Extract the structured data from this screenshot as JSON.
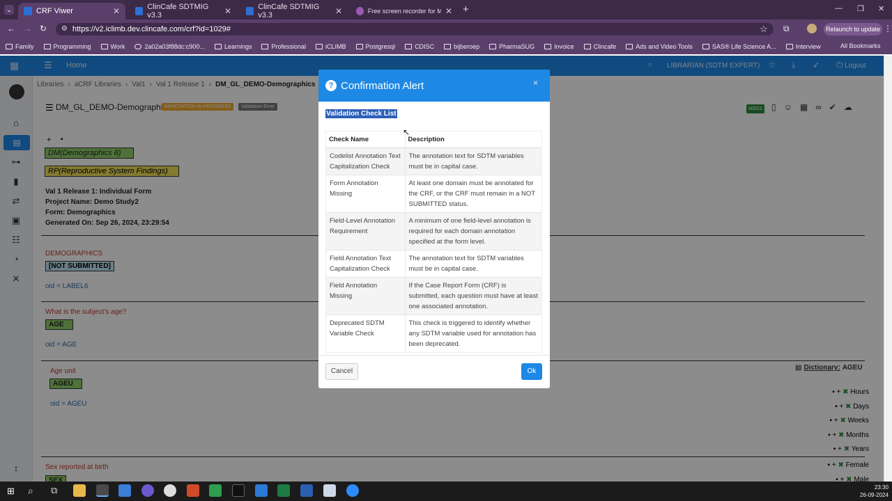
{
  "browser": {
    "tabs": [
      {
        "label": "CRF Viwer",
        "active": true
      },
      {
        "label": "ClinCafe SDTMIG v3.3",
        "active": false
      },
      {
        "label": "ClinCafe SDTMIG v3.3",
        "active": false
      },
      {
        "label": "Free screen recorder for Mac a",
        "active": false
      }
    ],
    "url": "https://v2.iclimb.dev.clincafe.com/crf?id=1029#",
    "relaunch_label": "Relaunch to update",
    "bookmarks": [
      "Family",
      "Programming",
      "Work",
      "2a02a03f88dc:c900...",
      "Learnings",
      "Professional",
      "iCLIMB",
      "Postgresql",
      "CDISC",
      "bijberoep",
      "PharmaSUG",
      "Invoice",
      "Clincafe",
      "Ads and Video Tools",
      "SAS® Life Science A...",
      "Interview"
    ],
    "all_bookmarks": "All Bookmarks"
  },
  "topnav": {
    "home": "Home",
    "user": "LIBRARIAN (SDTM EXPERT)",
    "logout": "Logout"
  },
  "breadcrumb": [
    "Libraries",
    "aCRF Libraries",
    "Val1",
    "Val 1 Release 1",
    "DM_GL_DEMO-Demographics"
  ],
  "page": {
    "title": "DM_GL_DEMO-Demographics",
    "badge_progress": "ANNOTATION IN PROGRESS",
    "badge_error": "Validation Error",
    "msg_badge": "MSG2",
    "domain1": "DM(Demographics 8)",
    "domain2": "RP(Reproductive System Findings)",
    "meta": [
      "Val 1 Release 1: Individual Form",
      "Project Name: Demo Study2",
      "Form: Demographics",
      "Generated On: Sep 26, 2024, 23:29:54"
    ],
    "section": "DEMOGRAPHICS",
    "status": "[NOT SUBMITTED]",
    "oid_label6": "oid = LABEL6",
    "q_age": "What is the subject's age?",
    "age": "AGE",
    "oid_age": "oid = AGE",
    "q_ageunit": "Age unit",
    "ageu": "AGEU",
    "oid_ageu": "oid = AGEU",
    "dictionary_label": "Dictionary:",
    "dictionary_value": "AGEU",
    "ageu_terms": [
      "Hours",
      "Days",
      "Weeks",
      "Months",
      "Years"
    ],
    "q_sex": "Sex reported at birth",
    "sex": "SEX",
    "sex_terms": [
      "Female",
      "Male"
    ]
  },
  "modal": {
    "title": "Confirmation Alert",
    "close": "×",
    "section_label": "Validation Check List",
    "columns": [
      "Check Name",
      "Description"
    ],
    "rows": [
      {
        "name": "Codelist Annotation Text Capitalization Check",
        "desc": "The annotation text for SDTM variables must be in capital case."
      },
      {
        "name": "Form Annotation Missing",
        "desc": "At least one domain must be annotated for the CRF, or the CRF must remain in a NOT SUBMITTED status."
      },
      {
        "name": "Field-Level Annotation Requirement",
        "desc": "A minimum of one field-level annotation is required for each domain annotation specified at the form level."
      },
      {
        "name": "Field Annotation Text Capitalization Check",
        "desc": "The annotation text for SDTM variables must be in capital case."
      },
      {
        "name": "Field Annotation Missing",
        "desc": "If the Case Report Form (CRF) is submitted, each question must have at least one associated annotation."
      },
      {
        "name": "Deprecated SDTM Variable Check",
        "desc": "This check is triggered to identify whether any SDTM variable used for annotation has been deprecated."
      }
    ],
    "cancel": "Cancel",
    "ok": "Ok"
  },
  "taskbar": {
    "time": "23:30",
    "date": "26-09-2024"
  }
}
